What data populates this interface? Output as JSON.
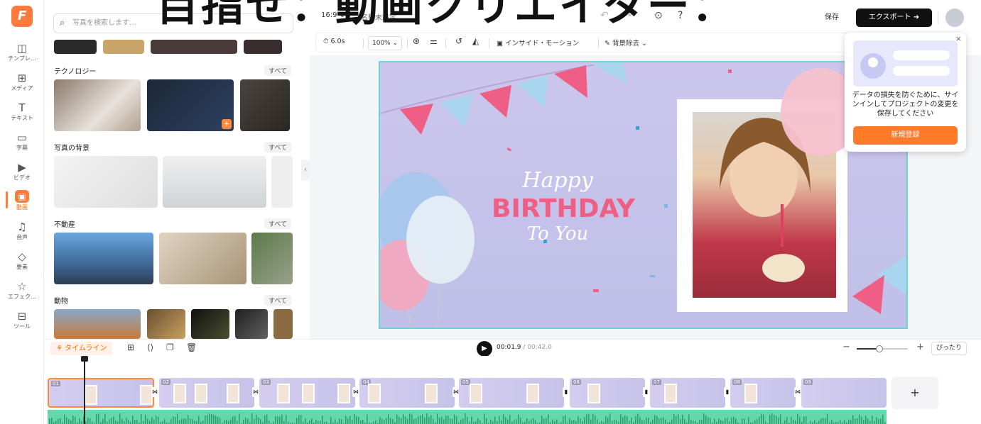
{
  "overlay": {
    "title": "目指せ：動画クリエイター："
  },
  "rail": {
    "logo": "F",
    "items": [
      {
        "label": "テンプレ…",
        "icon": "template-icon",
        "glyph": "◫"
      },
      {
        "label": "メディア",
        "icon": "media-icon",
        "glyph": "⊞"
      },
      {
        "label": "テキスト",
        "icon": "text-icon",
        "glyph": "T"
      },
      {
        "label": "字幕",
        "icon": "subtitle-icon",
        "glyph": "▭"
      },
      {
        "label": "ビデオ",
        "icon": "video-icon",
        "glyph": "▶"
      },
      {
        "label": "動画",
        "icon": "stock-video-icon",
        "glyph": "▣"
      },
      {
        "label": "音声",
        "icon": "music-icon",
        "glyph": "♫"
      },
      {
        "label": "要素",
        "icon": "elements-icon",
        "glyph": "◇"
      },
      {
        "label": "エフェク…",
        "icon": "effects-icon",
        "glyph": "☆"
      },
      {
        "label": "ツール",
        "icon": "tools-icon",
        "glyph": "⊟"
      }
    ]
  },
  "panel": {
    "search_placeholder": "写真を検索します…",
    "see_all": "すべて",
    "sections": [
      {
        "title": "テクノロジー"
      },
      {
        "title": "写真の背景"
      },
      {
        "title": "不動産"
      },
      {
        "title": "動物"
      }
    ]
  },
  "topbar": {
    "ratio": "16:9 ⌄",
    "project_name": "名称未設定",
    "save": "保存",
    "export": "エクスポート ➜"
  },
  "toolbar": {
    "duration": "6.0s",
    "zoom": "100% ⌄",
    "inside_motion": "インサイド・モーション",
    "bg_remove": "背景除去 ⌄"
  },
  "canvas": {
    "happy": "Happy",
    "birthday": "BIRTHDAY",
    "to_you": "To You"
  },
  "popup": {
    "message": "データの損失を防ぐために、サインインしてプロジェクトの変更を保存してください",
    "signup": "新規登録",
    "close": "×"
  },
  "timeline": {
    "tab": "タイムライン",
    "current": "00:01.9",
    "total": "/ 00:42.0",
    "fit": "ぴったり",
    "zoom_level": 0.45,
    "clips": [
      "01",
      "02",
      "03",
      "04",
      "05",
      "06",
      "07",
      "08",
      "09"
    ]
  },
  "colors": {
    "accent": "#ff7a3d",
    "birthday_pink": "#f0527a",
    "canvas_border": "#6fd3d8",
    "audio_wave": "#64d8ac"
  }
}
